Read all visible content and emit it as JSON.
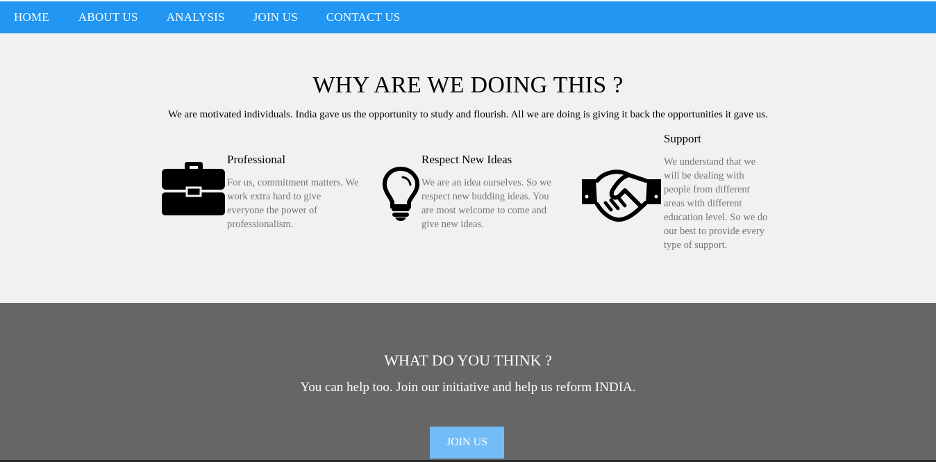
{
  "nav": {
    "items": [
      {
        "label": "HOME"
      },
      {
        "label": "ABOUT US"
      },
      {
        "label": "ANALYSIS"
      },
      {
        "label": "JOIN US"
      },
      {
        "label": "CONTACT US"
      }
    ]
  },
  "why": {
    "title": "WHY ARE WE DOING THIS ?",
    "intro": "We are motivated individuals. India gave us the opportunity to study and flourish. All we are doing is giving it back the opportunities it gave us.",
    "features": [
      {
        "icon": "briefcase-icon",
        "title": "Professional",
        "description": "For us, commitment matters. We work extra hard to give everyone the power of professionalism."
      },
      {
        "icon": "lightbulb-icon",
        "title": "Respect New Ideas",
        "description": "We are an idea ourselves. So we respect new budding ideas. You are most welcome to come and give new ideas."
      },
      {
        "icon": "handshake-icon",
        "title": "Support",
        "description": "We understand that we will be dealing with people from different areas with different education level. So we do our best to provide every type of support."
      }
    ]
  },
  "think": {
    "title": "WHAT DO YOU THINK ?",
    "subtitle": "You can help too. Join our initiative and help us reform INDIA.",
    "button_label": "JOIN US"
  },
  "colors": {
    "nav_bg": "#2196f3",
    "why_bg": "#f1f1f1",
    "think_bg": "#666666",
    "button_bg": "#72bdf7",
    "muted_text": "#757575"
  }
}
